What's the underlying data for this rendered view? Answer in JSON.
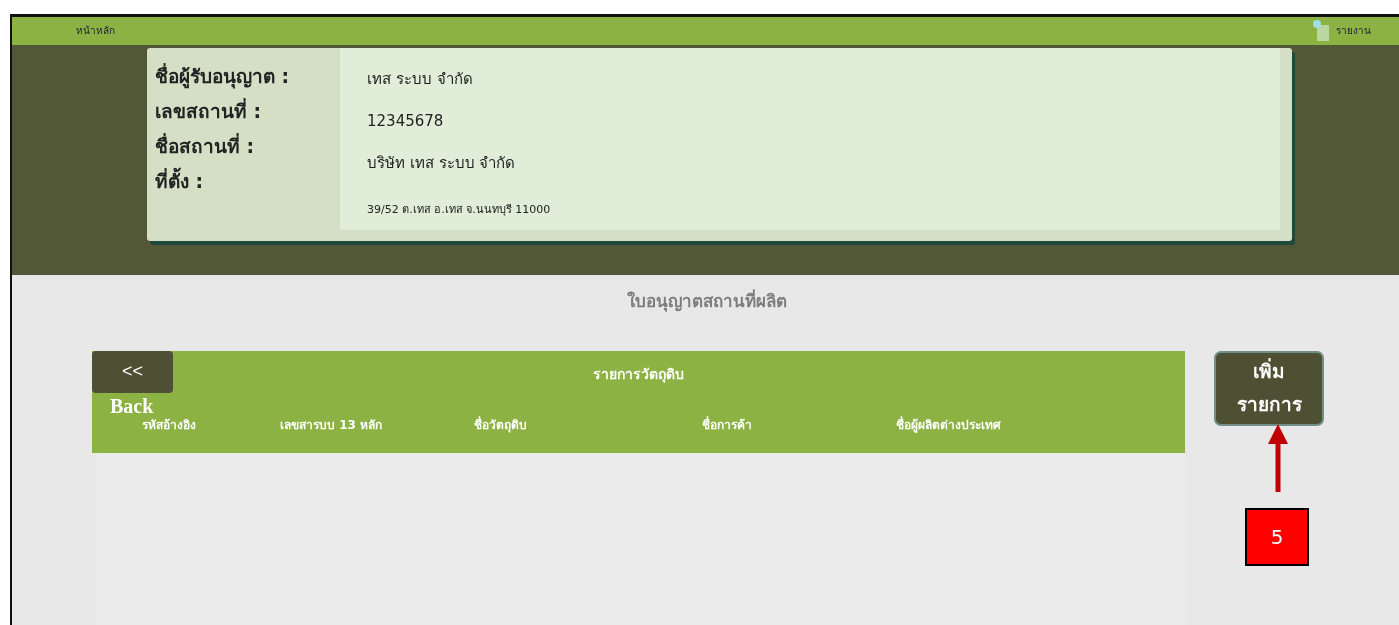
{
  "top_bar": {
    "home_link": "หน้าหลัก",
    "report_link": "รายงาน"
  },
  "licensee": {
    "fields": [
      {
        "label": "ชื่อผู้รับอนุญาต :",
        "value": "เทส ระบบ จำกัด"
      },
      {
        "label": "เลขสถานที่ :",
        "value": "12345678"
      },
      {
        "label": "ชื่อสถานที่ :",
        "value": "บริษัท เทส ระบบ จำกัด"
      },
      {
        "label": "ที่ตั้ง :",
        "value": "39/52  ต.เทส อ.เทส จ.นนทบุรี  11000"
      }
    ]
  },
  "page_title": "ใบอนุญาตสถานที่ผลิต",
  "back_button": {
    "icon": "<<",
    "label": "Back"
  },
  "table": {
    "title": "รายการวัตถุดิบ",
    "columns": [
      "รหัสอ้างอิง",
      "เลขสารบบ 13 หลัก",
      "ชื่อวัตถุดิบ",
      "ชื่อการค้า",
      "ชื่อผู้ผลิตต่างประเทศ"
    ]
  },
  "add_button": {
    "label": "เพิ่ม\nรายการ"
  },
  "annotation": {
    "number": "5"
  }
}
